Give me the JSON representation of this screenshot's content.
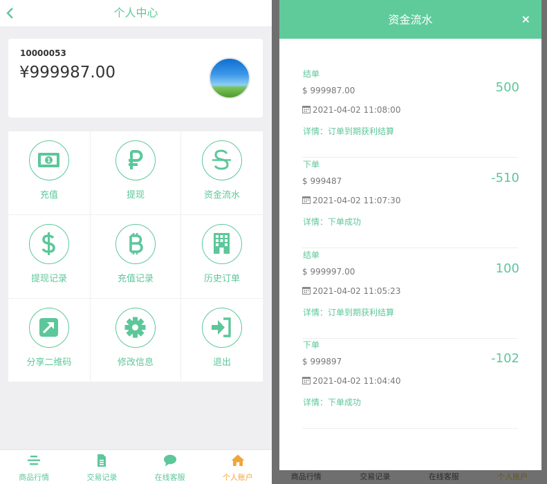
{
  "header": {
    "title": "个人中心"
  },
  "account": {
    "id": "10000053",
    "balance": "¥999987.00"
  },
  "menu": [
    {
      "label": "充值",
      "icon": "cash-icon"
    },
    {
      "label": "提现",
      "icon": "ruble-icon"
    },
    {
      "label": "资金流水",
      "icon": "strikethrough-s-icon"
    },
    {
      "label": "提现记录",
      "icon": "dollar-icon"
    },
    {
      "label": "充值记录",
      "icon": "bitcoin-icon"
    },
    {
      "label": "历史订单",
      "icon": "building-icon"
    },
    {
      "label": "分享二维码",
      "icon": "share-arrow-icon"
    },
    {
      "label": "修改信息",
      "icon": "gear-icon"
    },
    {
      "label": "退出",
      "icon": "sign-in-icon"
    }
  ],
  "nav": [
    {
      "label": "商品行情",
      "icon": "list-icon"
    },
    {
      "label": "交易记录",
      "icon": "document-icon"
    },
    {
      "label": "在线客服",
      "icon": "chat-icon"
    },
    {
      "label": "个人账户",
      "icon": "home-icon"
    }
  ],
  "modal": {
    "title": "资金流水",
    "close": "×",
    "records": [
      {
        "type": "结单",
        "balance": "$ 999987.00",
        "time": "2021-04-02 11:08:00",
        "detail": "详情：订单到期获利结算",
        "amount": "500"
      },
      {
        "type": "下单",
        "balance": "$ 999487",
        "time": "2021-04-02 11:07:30",
        "detail": "详情：下单成功",
        "amount": "-510"
      },
      {
        "type": "结单",
        "balance": "$ 999997.00",
        "time": "2021-04-02 11:05:23",
        "detail": "详情：订单到期获利结算",
        "amount": "100"
      },
      {
        "type": "下单",
        "balance": "$ 999897",
        "time": "2021-04-02 11:04:40",
        "detail": "详情：下单成功",
        "amount": "-102"
      }
    ]
  },
  "colors": {
    "accent": "#5cc79a",
    "header": "#5fcb9b",
    "active_nav": "#f0a53a"
  }
}
